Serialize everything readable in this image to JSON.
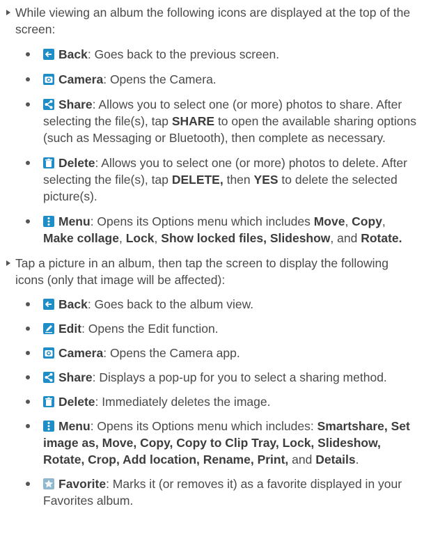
{
  "section1": {
    "intro": "While viewing an album the following icons are displayed at the top of the screen:",
    "items": [
      {
        "icon": "back-arrow-icon",
        "term": "Back",
        "desc": ": Goes back to the previous screen."
      },
      {
        "icon": "camera-icon",
        "term": "Camera",
        "desc": ": Opens the Camera."
      },
      {
        "icon": "share-icon",
        "term": "Share",
        "d1": ": Allows you to select one (or more) photos to share. After selecting the file(s), tap ",
        "k1": "SHARE",
        "d2": " to open the available sharing options (such as Messaging or Bluetooth), then complete as necessary."
      },
      {
        "icon": "trash-icon",
        "term": "Delete",
        "d1": ": Allows you to select one (or more) photos to delete. After selecting the file(s), tap ",
        "k1": "DELETE,",
        "d2": " then ",
        "k2": "YES",
        "d3": " to delete the selected picture(s)."
      },
      {
        "icon": "menu-dots-icon",
        "term": "Menu",
        "d1": ": Opens its Options menu which includes ",
        "k1": "Move",
        "s1": ", ",
        "k2": "Copy",
        "s2": ", ",
        "k3": "Make collage",
        "s3": ", ",
        "k4": "Lock",
        "s4": ", ",
        "k5": "Show locked files,",
        "s5": " ",
        "k6": "Slideshow",
        "s6": ", and ",
        "k7": "Rotate."
      }
    ]
  },
  "section2": {
    "intro": "Tap a picture in an album, then tap the screen to display the following icons (only that image will be affected):",
    "items": [
      {
        "icon": "back-arrow-icon",
        "term": "Back",
        "desc": ": Goes back to the album view."
      },
      {
        "icon": "edit-icon",
        "term": "Edit",
        "desc": ": Opens the Edit function."
      },
      {
        "icon": "camera-icon",
        "term": "Camera",
        "desc": ": Opens the Camera app."
      },
      {
        "icon": "share-icon",
        "term": "Share",
        "desc": ": Displays a pop-up for you to select a sharing method."
      },
      {
        "icon": "trash-icon",
        "term": "Delete",
        "desc": ": Immediately deletes the image."
      },
      {
        "icon": "menu-dots-icon",
        "term": "Menu",
        "d1": ": Opens its Options menu which includes: ",
        "k1": "Smartshare, Set image as, Move, Copy, Copy to Clip Tray, Lock, Slideshow, Rotate, Crop, Add location, Rename, Print,",
        "d2": " and ",
        "k2": "Details",
        "d3": "."
      },
      {
        "icon": "star-icon",
        "term": "Favorite",
        "desc": ": Marks it (or removes it) as a favorite displayed in your Favorites album."
      }
    ]
  },
  "colors": {
    "icon_blue": "#1f8ec7",
    "icon_star_bg": "#8fb8cf",
    "text": "#4a4a4a"
  }
}
